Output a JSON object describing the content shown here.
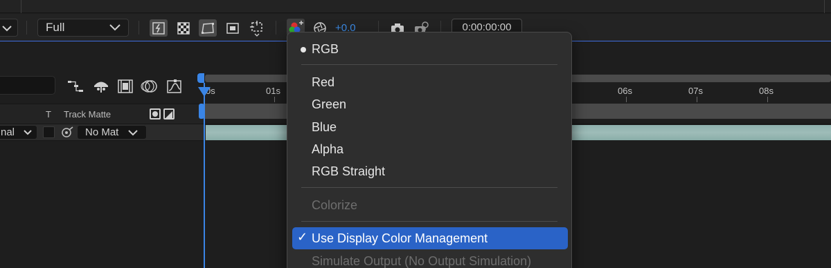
{
  "toolbar": {
    "resolution_value": "Full",
    "exposure_value": "+0.0",
    "timecode": "0:00:00:00",
    "icons": [
      "fast-previews-icon",
      "transparency-grid-icon",
      "mask-path-visibility-icon",
      "region-of-interest-icon",
      "grid-guides-icon",
      "color-channels-icon",
      "reset-exposure-icon",
      "snapshot-icon",
      "show-snapshot-icon"
    ]
  },
  "timeline": {
    "column_t": "T",
    "column_track_matte": "Track Matte",
    "layer_row": {
      "mode_value": "nal",
      "track_matte_value": "No Mat"
    },
    "ruler_labels": [
      "0s",
      "01s",
      "06s",
      "07s",
      "08s"
    ],
    "playhead_color": "#3a85e6",
    "clip_color": "#9ebcb8"
  },
  "channel_menu": {
    "rgb": "RGB",
    "red": "Red",
    "green": "Green",
    "blue": "Blue",
    "alpha": "Alpha",
    "rgb_straight": "RGB Straight",
    "colorize": "Colorize",
    "use_display_cm": "Use Display Color Management",
    "simulate_output": "Simulate Output (No Output Simulation)",
    "check_mark": "✓",
    "highlight_color": "#2a63c7"
  }
}
